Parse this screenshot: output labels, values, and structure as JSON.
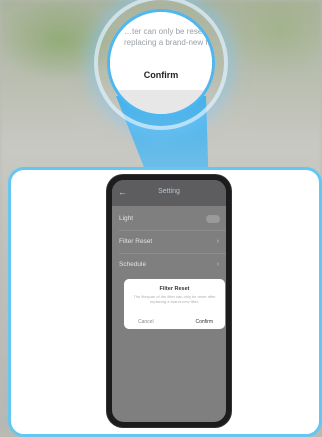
{
  "magnifier": {
    "text": "…ter can only be reset after replacing a brand-new filter.",
    "confirm_label": "Confirm"
  },
  "app": {
    "back_glyph": "←",
    "title": "Setting",
    "rows": [
      {
        "label": "Light",
        "control": "toggle"
      },
      {
        "label": "Filter Reset",
        "control": "chevron"
      },
      {
        "label": "Schedule",
        "control": "chevron"
      }
    ],
    "chevron_glyph": "›"
  },
  "dialog": {
    "title": "Filter Reset",
    "body": "The lifespan of the filter can only be reset after replacing a brand-new filter.",
    "cancel_label": "Cancel",
    "confirm_label": "Confirm"
  },
  "colors": {
    "accent": "#4fb7f0",
    "card_border": "#63c7f2"
  }
}
